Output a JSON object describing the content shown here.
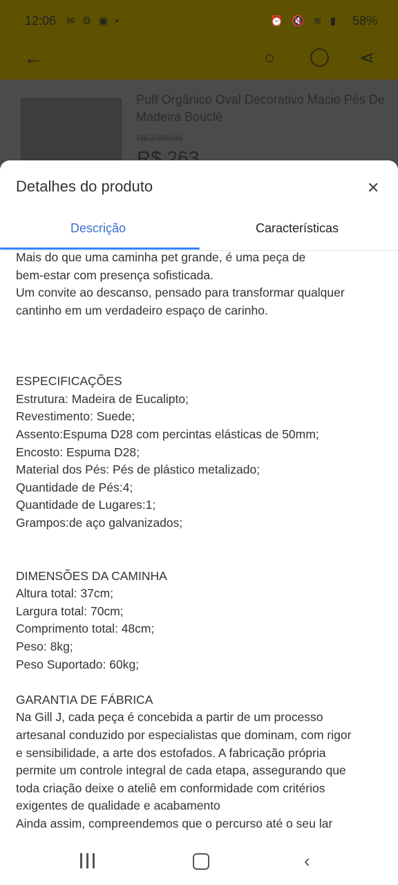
{
  "status": {
    "time": "12:06",
    "battery": "58%"
  },
  "product_bg": {
    "title": "Puff Orgânico Oval Decorativo Macio Pés De Madeira Bouclê",
    "old_price": "R$ 2.999,00",
    "price": "R$ 263"
  },
  "sheet": {
    "title": "Detalhes do produto",
    "tabs": [
      "Descrição",
      "Características"
    ],
    "active_tab": "Descrição",
    "description": "Mais do que uma caminha pet grande, é uma peça de\nbem-estar com presença sofisticada.\nUm convite ao descanso, pensado para transformar qualquer\ncantinho em um verdadeiro espaço de carinho.\n\n\n\nESPECIFICAÇÕES\nEstrutura: Madeira de Eucalipto;\nRevestimento: Suede;\nAssento:Espuma D28 com percintas elásticas de 50mm;\nEncosto: Espuma D28;\nMaterial dos Pés: Pés de plástico metalizado;\nQuantidade de Pés:4;\nQuantidade de Lugares:1;\nGrampos:de aço galvanizados;\n\n\nDIMENSÕES DA CAMINHA\nAltura total: 37cm;\nLargura total: 70cm;\nComprimento total: 48cm;\nPeso: 8kg;\nPeso Suportado: 60kg;\n\nGARANTIA DE FÁBRICA\nNa Gill J, cada peça é concebida a partir de um processo\nartesanal conduzido por especialistas que dominam, com rigor\ne sensibilidade, a arte dos estofados. A fabricação própria\npermite um controle integral de cada etapa, assegurando que\ntoda criação deixe o ateliê em conformidade com critérios\nexigentes de qualidade e acabamento\nAinda assim, compreendemos que o percurso até o seu lar"
  },
  "icons": {
    "back": "arrow-left-icon",
    "search": "search-icon",
    "whatsapp": "whatsapp-icon",
    "share": "share-icon",
    "close": "close-icon"
  },
  "colors": {
    "accent": "#3483fa",
    "active_tab_text": "#3b6fd1",
    "header_dimmed": "#5e5200"
  }
}
